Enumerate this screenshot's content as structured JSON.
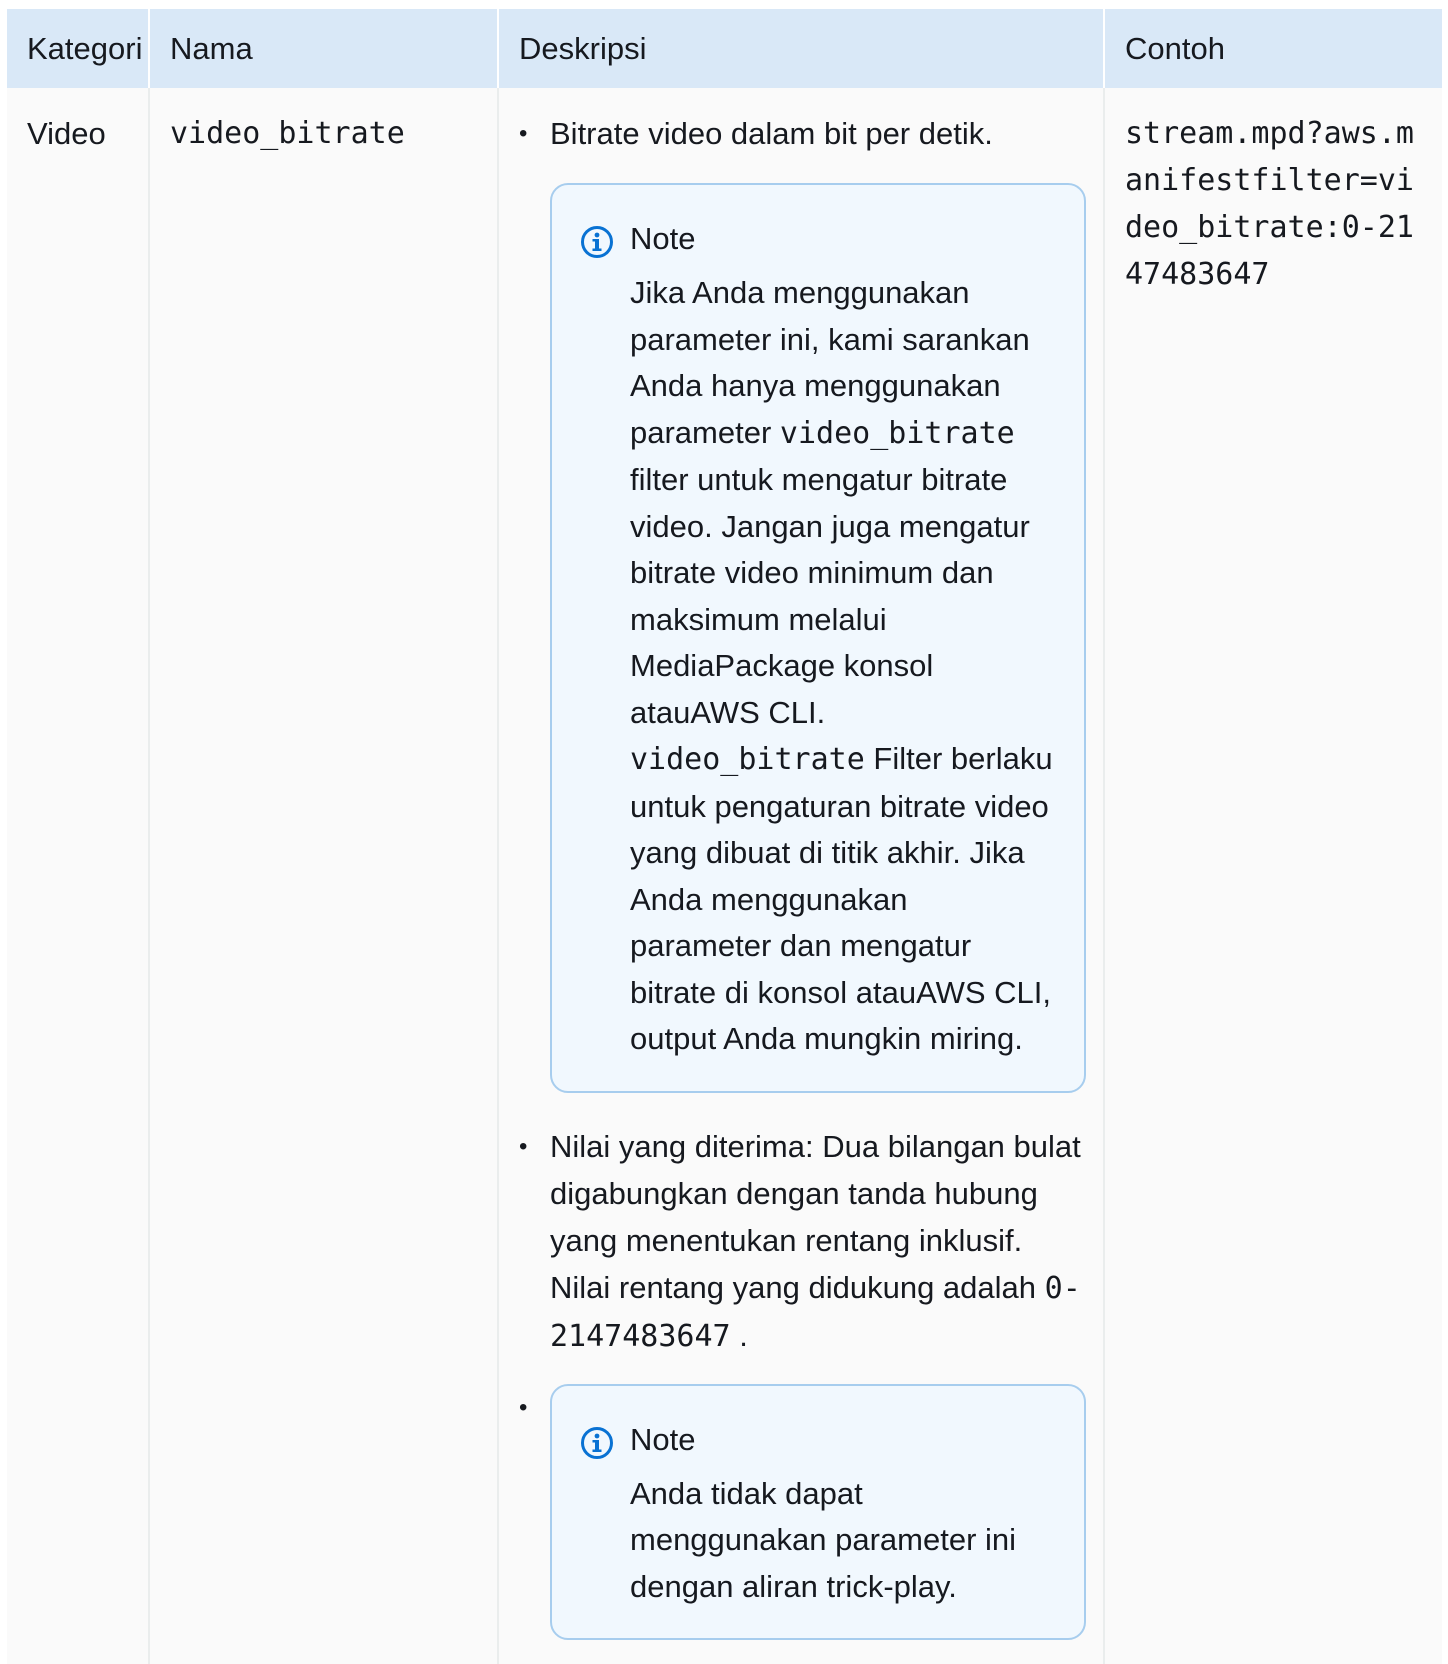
{
  "table": {
    "headers": {
      "kategori": "Kategori",
      "nama": "Nama",
      "deskripsi": "Deskripsi",
      "contoh": "Contoh"
    },
    "row": {
      "kategori": "Video",
      "nama": "video_bitrate",
      "contoh": "stream.mpd?aws.manifestfilter=video_bitrate:0-2147483647",
      "deskripsi": {
        "item1_text": "Bitrate video dalam bit per detik.",
        "note1": {
          "title": "Note",
          "icon": "info-icon",
          "body_part1": "Jika Anda menggunakan parameter ini, kami sarankan Anda hanya menggunakan parameter ",
          "code1": "video_bitrate",
          "body_part2": " filter untuk mengatur bitrate video. Jangan juga mengatur bitrate video minimum dan maksimum melalui MediaPackage konsol atauAWS CLI. ",
          "code2": "video_bitrate",
          "body_part3": " Filter berlaku untuk pengaturan bitrate video yang dibuat di titik akhir. Jika Anda menggunakan parameter dan mengatur bitrate di konsol atauAWS CLI, output Anda mungkin miring."
        },
        "item2_text": "Nilai yang diterima: Dua bilangan bulat digabungkan dengan tanda hubung yang menentukan rentang inklusif. Nilai rentang yang didukung adalah ",
        "item2_code": "0-2147483647",
        "item2_end": " .",
        "note2": {
          "title": "Note",
          "icon": "info-icon",
          "body": "Anda tidak dapat menggunakan parameter ini dengan aliran trick-play."
        }
      }
    }
  },
  "colors": {
    "header_bg": "#d9e8f7",
    "cell_bg": "#fafafa",
    "note_bg": "#f1f8fe",
    "note_border": "#a7cdee",
    "info_icon": "#0972d3"
  }
}
